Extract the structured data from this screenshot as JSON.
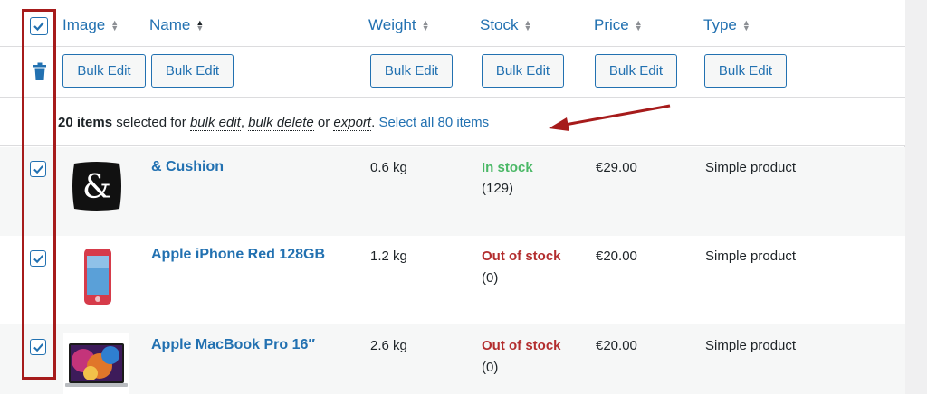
{
  "columns": {
    "image": "Image",
    "name": "Name",
    "weight": "Weight",
    "stock": "Stock",
    "price": "Price",
    "type": "Type"
  },
  "bulk_edit_label": "Bulk Edit",
  "selection_notice": {
    "count": "20 items",
    "text1": " selected for ",
    "bulk_edit": "bulk edit",
    "comma": ", ",
    "bulk_delete": "bulk delete",
    "or": " or ",
    "export": "export",
    "period": ". ",
    "select_all": "Select all 80 items"
  },
  "rows": [
    {
      "name": "& Cushion",
      "weight": "0.6 kg",
      "stock_status": "In stock",
      "stock_count": "(129)",
      "price": "€29.00",
      "type": "Simple product",
      "image_text": "&"
    },
    {
      "name": "Apple iPhone Red 128GB",
      "weight": "1.2 kg",
      "stock_status": "Out of stock",
      "stock_count": "(0)",
      "price": "€20.00",
      "type": "Simple product"
    },
    {
      "name": "Apple MacBook Pro 16″",
      "weight": "2.6 kg",
      "stock_status": "Out of stock",
      "stock_count": "(0)",
      "price": "€20.00",
      "type": "Simple product"
    }
  ],
  "colors": {
    "link": "#2271b1",
    "in_stock": "#4ab866",
    "out_of_stock": "#b32d2e",
    "highlight": "#a61b1b"
  }
}
